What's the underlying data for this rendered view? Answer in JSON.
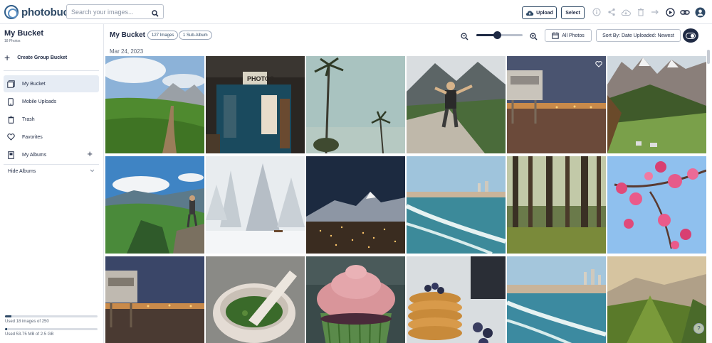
{
  "app": {
    "logo_text": "photobucket"
  },
  "search": {
    "placeholder": "Search your images..."
  },
  "toolbar": {
    "upload_label": "Upload",
    "select_label": "Select",
    "icons": [
      "info-icon",
      "share-icon",
      "cloud-download-icon",
      "trash-icon",
      "move-icon",
      "slideshow-icon",
      "link-icon",
      "account-icon"
    ]
  },
  "sidebar": {
    "title": "My Bucket",
    "subtitle": "18 Photos",
    "create_label": "Create Group Bucket",
    "items": [
      {
        "label": "My Bucket",
        "icon": "photos-icon",
        "active": true
      },
      {
        "label": "Mobile Uploads",
        "icon": "phone-icon",
        "active": false
      },
      {
        "label": "Trash",
        "icon": "trash-icon",
        "active": false
      },
      {
        "label": "Favorites",
        "icon": "heart-icon",
        "active": false
      },
      {
        "label": "My Albums",
        "icon": "album-icon",
        "active": false
      }
    ],
    "hide_albums_label": "Hide Albums",
    "usage": [
      {
        "text": "Used 18 images of 250",
        "fraction": 0.072
      },
      {
        "text": "Used 53.75 MB of 2.5 GB",
        "fraction": 0.021
      }
    ]
  },
  "main": {
    "title": "My Bucket",
    "images_pill": "127 Images",
    "subalbum_pill": "1 Sub-Album",
    "zoom_level": 0.45,
    "all_photos_label": "All Photos",
    "sort_label": "Sort By: Date Uploaded: Newest",
    "date_label": "Mar 24, 2023",
    "help_label": "?"
  },
  "colors": {
    "brand": "#2f4a66",
    "accent": "#1f2a44",
    "active_bg": "#e6ecf4"
  },
  "photos": [
    "mountain-trail",
    "photo-booth",
    "palm-trees",
    "hiker-cliff",
    "lifeguard-tower-dusk",
    "alpine-peaks",
    "hiker-meadow",
    "snowy-forest",
    "mountain-town-night",
    "beach-waves",
    "forest-trees",
    "cherry-blossoms",
    "lifeguard-tower-night",
    "mortar-pestle",
    "pink-cupcake",
    "pancakes-berries",
    "beach-city",
    "green-ridge"
  ]
}
